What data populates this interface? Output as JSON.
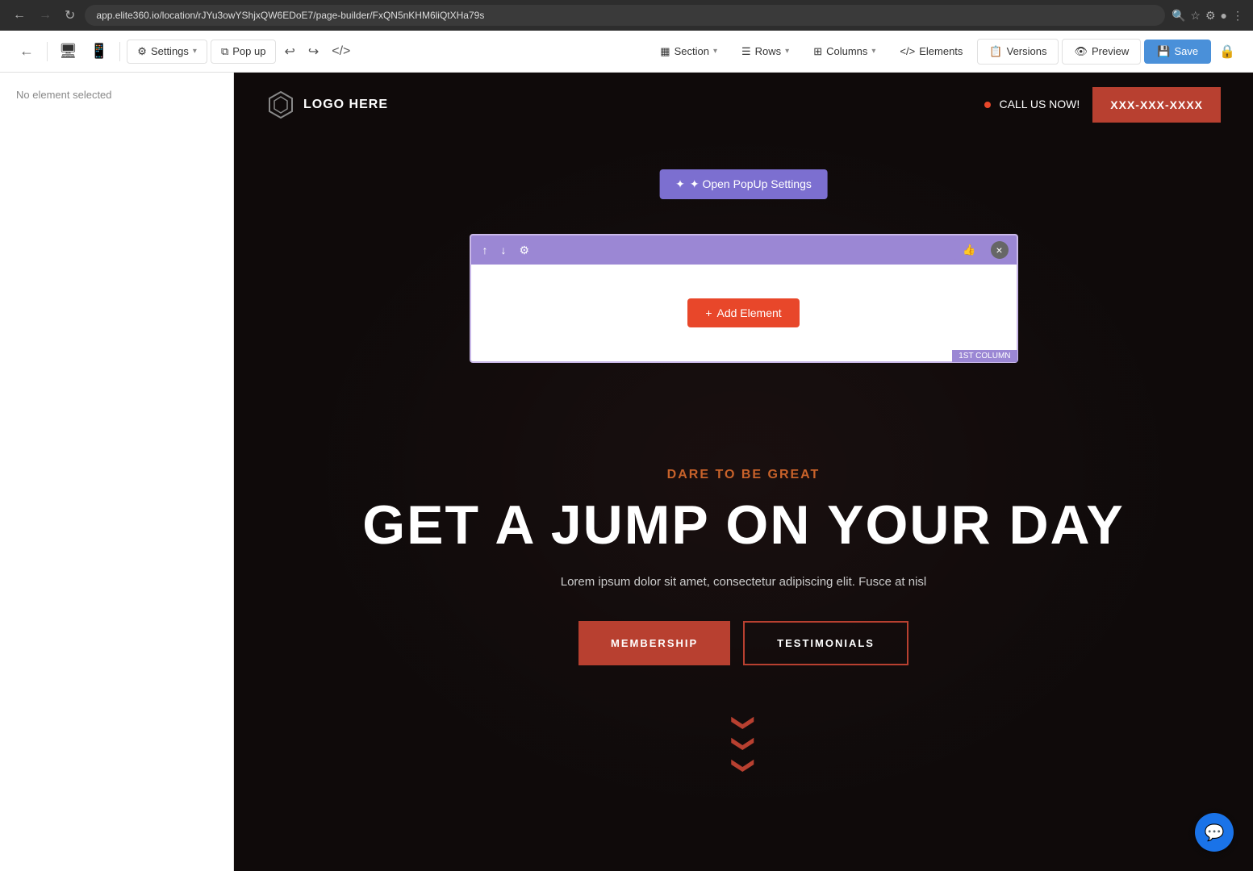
{
  "browser": {
    "url": "app.elite360.io/location/rJYu3owYShjxQW6EDoE7/page-builder/FxQN5nKHM6liQtXHa79s",
    "back_disabled": false,
    "forward_disabled": false
  },
  "toolbar": {
    "back_label": "←",
    "desktop_icon": "🖥",
    "mobile_icon": "📱",
    "settings_label": "Settings",
    "popup_label": "Pop up",
    "undo_label": "↩",
    "redo_label": "↪",
    "code_label": "</>",
    "section_label": "Section",
    "rows_label": "Rows",
    "columns_label": "Columns",
    "elements_label": "Elements",
    "versions_label": "Versions",
    "preview_label": "Preview",
    "save_label": "Save"
  },
  "left_panel": {
    "status_text": "No element selected"
  },
  "popup_settings": {
    "open_btn_label": "✦ Open PopUp Settings"
  },
  "column_editor": {
    "up_icon": "↑",
    "down_icon": "↓",
    "settings_icon": "⚙",
    "close_icon": "×",
    "thumb_icon": "👍",
    "add_element_label": "+ Add Element",
    "column_label": "1ST COLUMN"
  },
  "site_header": {
    "logo_text": "LOGO HERE",
    "call_label": "CALL US NOW!",
    "phone": "XXX-XXX-XXXX"
  },
  "hero": {
    "subtitle": "DARE TO BE GREAT",
    "title": "GET A JUMP ON YOUR DAY",
    "description": "Lorem ipsum dolor sit amet, consectetur adipiscing elit. Fusce at nisl",
    "btn_primary": "MEMBERSHIP",
    "btn_secondary": "TESTIMONIALS"
  },
  "chat_btn": {
    "icon": "💬"
  },
  "colors": {
    "primary_purple": "#9b87d4",
    "primary_red": "#e8472a",
    "brand_red": "#b84030",
    "dark_bg": "#1a1a1a",
    "header_cta": "#b84030"
  }
}
